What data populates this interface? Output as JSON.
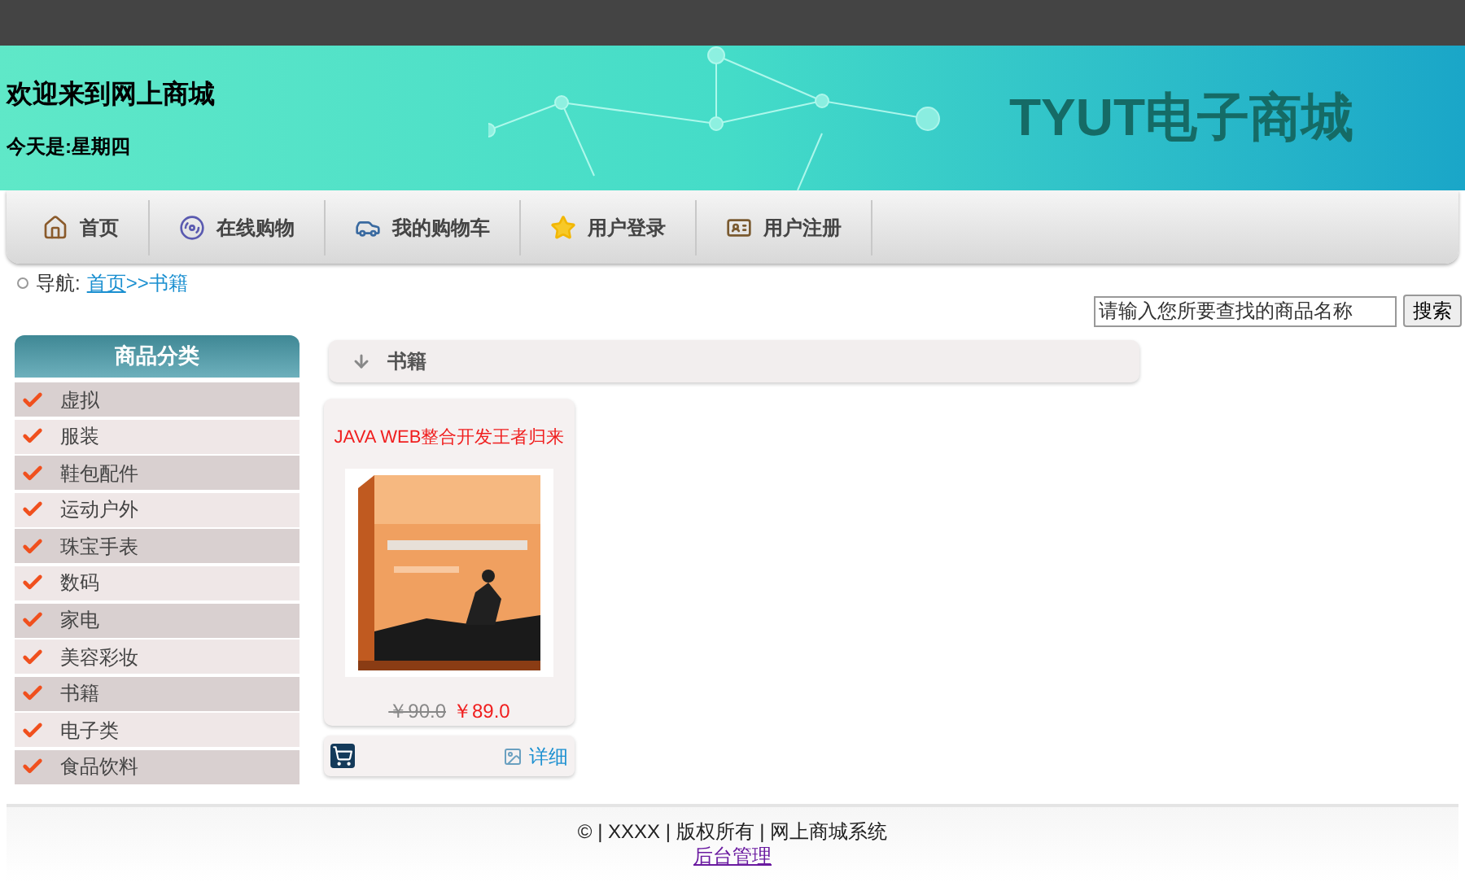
{
  "header": {
    "welcome": "欢迎来到网上商城",
    "today": "今天是:星期四",
    "logo": "TYUT电子商城"
  },
  "nav": [
    {
      "label": "首页",
      "kind": "home"
    },
    {
      "label": "在线购物",
      "kind": "shop"
    },
    {
      "label": "我的购物车",
      "kind": "cart"
    },
    {
      "label": "用户登录",
      "kind": "login"
    },
    {
      "label": "用户注册",
      "kind": "register"
    }
  ],
  "breadcrumb": {
    "label": "导航:",
    "link": "首页",
    "rest": ">>书籍"
  },
  "search": {
    "placeholder": "请输入您所要查找的商品名称",
    "button": "搜索"
  },
  "sidebar": {
    "title": "商品分类",
    "items": [
      "虚拟",
      "服装",
      "鞋包配件",
      "运动户外",
      "珠宝手表",
      "数码",
      "家电",
      "美容彩妆",
      "书籍",
      "电子类",
      "食品饮料"
    ]
  },
  "section": {
    "title": "书籍"
  },
  "products": [
    {
      "title": "JAVA WEB整合开发王者归来",
      "old_price": "￥90.0",
      "price": "￥89.0",
      "details": "详细"
    }
  ],
  "footer": {
    "text": "© | XXXX | 版权所有 | 网上商城系统",
    "link": "后台管理"
  }
}
